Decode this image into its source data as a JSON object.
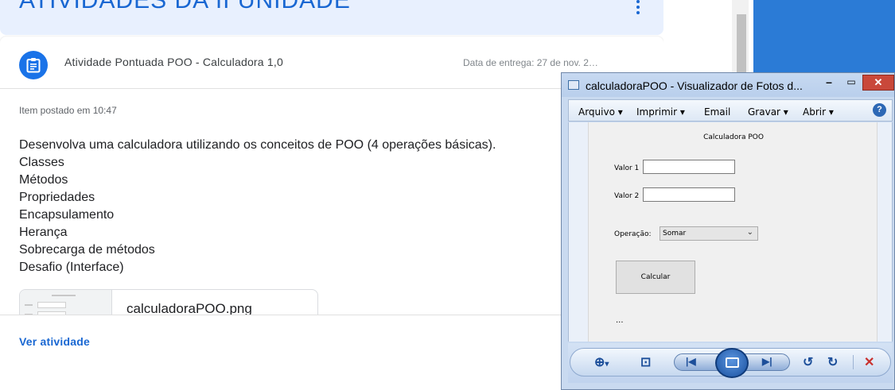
{
  "classroom": {
    "banner_title": "ATIVIDADES DA II UNIDADE",
    "activity_title": "Atividade Pontuada POO - Calculadora 1,0",
    "due": "Data de entrega: 27 de nov. 2…",
    "posted": "Item postado em 10:47",
    "description": [
      "Desenvolva uma calculadora utilizando os conceitos de POO (4 operações básicas).",
      "Classes",
      "Métodos",
      "Propriedades",
      "Encapsulamento",
      "Herança",
      "Sobrecarga de métodos",
      "Desafio (Interface)"
    ],
    "attachment_name": "calculadoraPOO.png",
    "view_link": "Ver atividade"
  },
  "photo_viewer": {
    "title": "calculadoraPOO - Visualizador de Fotos d...",
    "menu": {
      "arquivo": "Arquivo",
      "imprimir": "Imprimir",
      "email": "Email",
      "gravar": "Gravar",
      "abrir": "Abrir"
    },
    "help_symbol": "?",
    "app": {
      "title": "Calculadora POO",
      "valor1_label": "Valor 1",
      "valor2_label": "Valor 2",
      "operacao_label": "Operação:",
      "operacao_value": "Somar",
      "calcular_label": "Calcular",
      "result_text": "..."
    }
  },
  "colors": {
    "classroom_blue": "#1967d2",
    "banner_bg": "#e8f0fe",
    "desktop_blue": "#2b7bd6",
    "close_red": "#c9483a"
  },
  "icons": [
    "kebab-menu-icon",
    "assignment-icon",
    "photo-viewer-app-icon",
    "help-icon",
    "zoom-icon",
    "actual-size-icon",
    "previous-icon",
    "slideshow-icon",
    "next-icon",
    "rotate-left-icon",
    "rotate-right-icon",
    "delete-icon"
  ]
}
